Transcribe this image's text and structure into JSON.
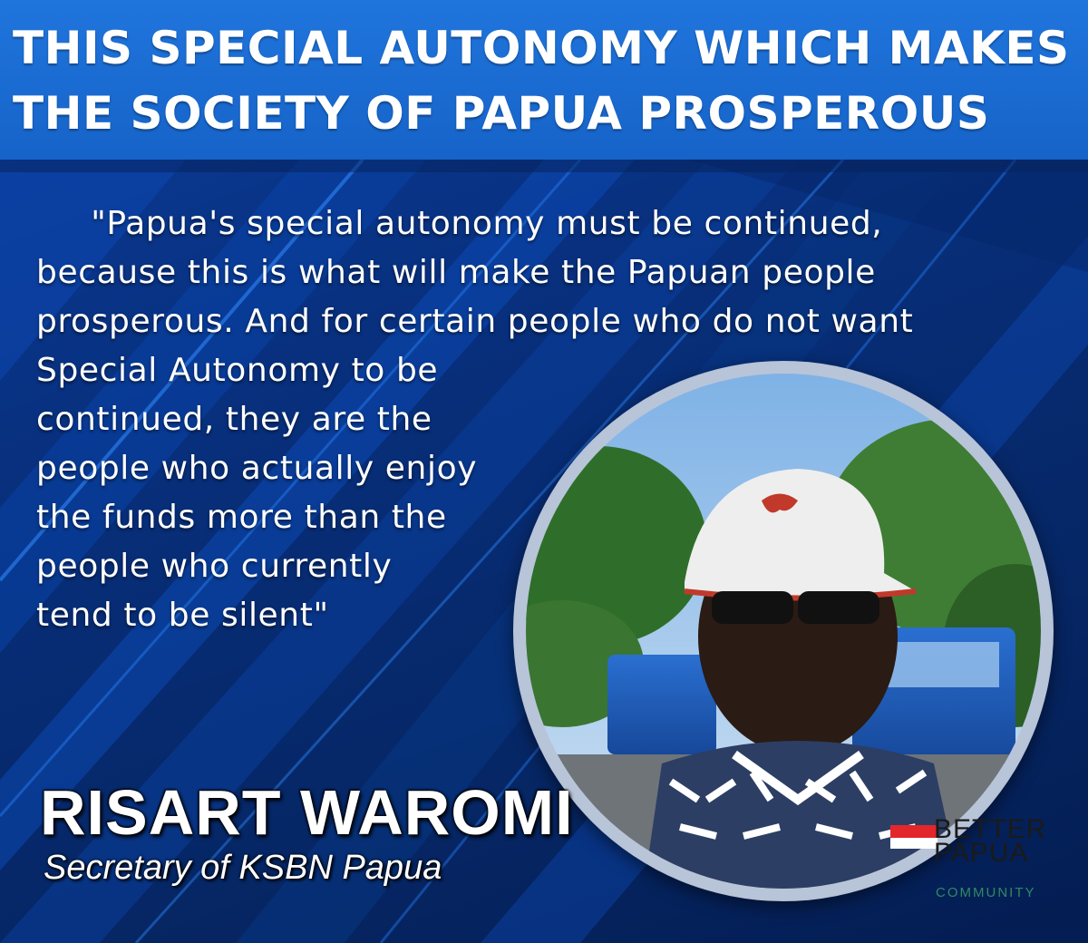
{
  "header": {
    "line1": "THIS SPECIAL AUTONOMY WHICH MAKES",
    "line2": "THE SOCIETY OF PAPUA PROSPEROUS"
  },
  "quote": {
    "lines": [
      "     \"Papua's special autonomy must be continued,",
      "because this is what will make the Papuan people",
      "prosperous. And for certain people who do not want",
      "Special Autonomy to be",
      "continued, they are the",
      "people who actually enjoy",
      "the funds more than the",
      "people who currently",
      "tend to be silent\""
    ]
  },
  "speaker": {
    "name": "RISART WAROMI",
    "title": "Secretary of KSBN Papua"
  },
  "logo": {
    "word1": "BETTER",
    "word2": "PAPUA",
    "subtitle": "COMMUNITY"
  },
  "colors": {
    "header_blue": "#1a6bd6",
    "background_blue": "#08307e",
    "logo_red": "#e3262b",
    "logo_green": "#2f8a63"
  }
}
